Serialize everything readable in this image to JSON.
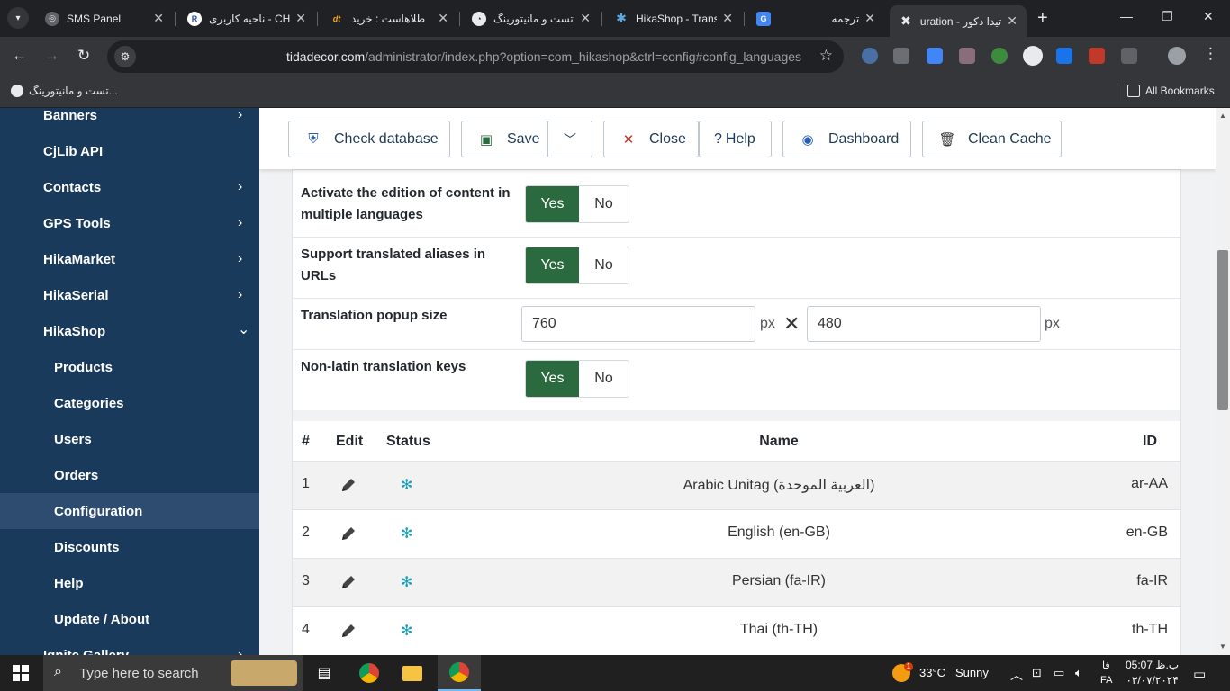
{
  "browser": {
    "tabs": [
      {
        "title": "SMS Panel",
        "icon": "globe-icon"
      },
      {
        "title": "ناحیه کاربری - CH",
        "icon": "r-logo-icon"
      },
      {
        "title": "طلاهاست : خرید",
        "icon": "dt-logo-icon"
      },
      {
        "title": "تست و مانیتورینگ -",
        "icon": "monitor-icon"
      },
      {
        "title": "HikaShop - Trans",
        "icon": "joomla-icon"
      },
      {
        "title": "ترجمه",
        "icon": "translate-icon"
      },
      {
        "title": "تیدا دکور - Configuration",
        "icon": "joomla-x-icon",
        "active": true
      }
    ],
    "url_host": "tidadecor.com",
    "url_path": "/administrator/index.php?option=com_hikashop&ctrl=config#config_languages",
    "bookmarks": {
      "left": "تست و مانیتورینگ...",
      "all": "All Bookmarks"
    }
  },
  "sidebar": {
    "items": [
      {
        "label": "Banners",
        "chevron": "›"
      },
      {
        "label": "CjLib API",
        "chevron": ""
      },
      {
        "label": "Contacts",
        "chevron": "›"
      },
      {
        "label": "GPS Tools",
        "chevron": "›"
      },
      {
        "label": "HikaMarket",
        "chevron": "›"
      },
      {
        "label": "HikaSerial",
        "chevron": "›"
      },
      {
        "label": "HikaShop",
        "chevron": "⌄"
      },
      {
        "label": "Products"
      },
      {
        "label": "Categories"
      },
      {
        "label": "Users"
      },
      {
        "label": "Orders"
      },
      {
        "label": "Configuration",
        "active": true
      },
      {
        "label": "Discounts"
      },
      {
        "label": "Help"
      },
      {
        "label": "Update / About"
      },
      {
        "label": "Ignite Gallery",
        "chevron": "›"
      }
    ]
  },
  "toolbar": {
    "check_database": "Check database",
    "save": "Save",
    "close": "Close",
    "help": "Help",
    "dashboard": "Dashboard",
    "clean_cache": "Clean Cache"
  },
  "options": {
    "multilang": {
      "label": "Activate the edition of content in multiple languages",
      "yes": "Yes",
      "no": "No",
      "value": "Yes"
    },
    "aliases": {
      "label": "Support translated aliases in URLs",
      "yes": "Yes",
      "no": "No",
      "value": "Yes"
    },
    "popup": {
      "label": "Translation popup size",
      "width": "760",
      "height": "480",
      "unit": "px",
      "times": "✕"
    },
    "nonlatin": {
      "label": "Non-latin translation keys",
      "yes": "Yes",
      "no": "No",
      "value": "Yes"
    }
  },
  "languages": {
    "headers": {
      "num": "#",
      "edit": "Edit",
      "status": "Status",
      "name": "Name",
      "id": "ID"
    },
    "rows": [
      {
        "num": "1",
        "name": "Arabic Unitag (العربية الموحدة)",
        "id": "ar-AA"
      },
      {
        "num": "2",
        "name": "English (en-GB)",
        "id": "en-GB"
      },
      {
        "num": "3",
        "name": "Persian (fa-IR)",
        "id": "fa-IR"
      },
      {
        "num": "4",
        "name": "Thai (th-TH)",
        "id": "th-TH"
      }
    ]
  },
  "taskbar": {
    "search_placeholder": "Type here to search",
    "weather_temp": "33°C",
    "weather_text": "Sunny",
    "weather_badge": "1",
    "lang_top": "فا",
    "lang_bottom": "FA",
    "time": "05:07 ب.ظ",
    "date": "۰۳/۰۷/۲۰۲۴"
  },
  "colors": {
    "sidebar_bg": "#1a3a5c",
    "sidebar_active": "#2d4c6f",
    "yes_green": "#2a6a3e",
    "status_teal": "#17a2b8"
  }
}
